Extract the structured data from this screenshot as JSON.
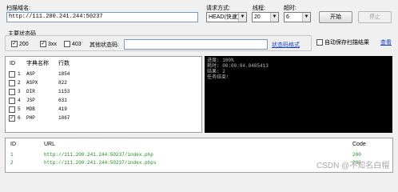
{
  "top": {
    "domain_label": "扫描域名:",
    "domain_value": "http://111.200.241.244:50237",
    "method_label": "请求方式:",
    "method_value": "HEAD(快速)",
    "threads_label": "线程:",
    "threads_value": "20",
    "timeout_label": "超时:",
    "timeout_value": "6",
    "start_button": "开始",
    "stop_button": "停止"
  },
  "status_codes": {
    "title": "主要状态码",
    "codes": [
      {
        "label": "200",
        "checked": true
      },
      {
        "label": "3xx",
        "checked": true
      },
      {
        "label": "403",
        "checked": false
      }
    ],
    "other_label": "其他状态码:",
    "format_link": "状态码格式",
    "autosave_label": "自动保存扫描结果",
    "view_link": "查看"
  },
  "dictionary": {
    "headers": [
      "ID",
      "字典名称",
      "行数"
    ],
    "rows": [
      {
        "id": "1",
        "name": "ASP",
        "lines": "1854",
        "checked": false
      },
      {
        "id": "2",
        "name": "ASPX",
        "lines": "822",
        "checked": false
      },
      {
        "id": "3",
        "name": "DIR",
        "lines": "1153",
        "checked": false
      },
      {
        "id": "4",
        "name": "JSP",
        "lines": "631",
        "checked": false
      },
      {
        "id": "5",
        "name": "MDB",
        "lines": "419",
        "checked": false
      },
      {
        "id": "6",
        "name": "PHP",
        "lines": "1067",
        "checked": true
      }
    ]
  },
  "log": {
    "lines": [
      "进度: 100%",
      "耗时: 00:00:04.0485413",
      "结果: 2",
      "任务结束!"
    ]
  },
  "results": {
    "headers": [
      "ID",
      "URL",
      "Code"
    ],
    "rows": [
      {
        "id": "1",
        "url": "http://111.200.241.244:50237/index.php",
        "code": "200"
      },
      {
        "id": "2",
        "url": "http://111.200.241.244:50237/index.phps",
        "code": "200"
      }
    ]
  },
  "watermark": "CSDN @不知名白帽",
  "colors": {
    "result_green": "#1e8c1e",
    "link_blue": "#1a3ec8",
    "log_bg": "#000000"
  }
}
